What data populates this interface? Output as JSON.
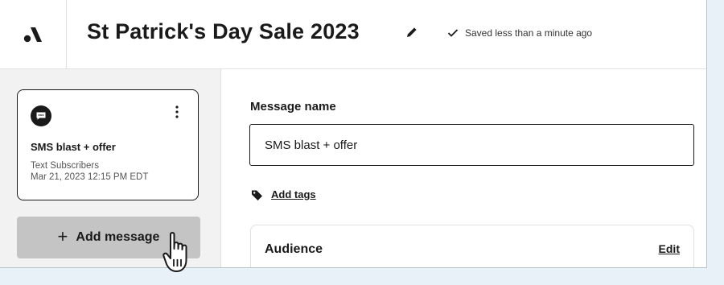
{
  "header": {
    "title": "St Patrick's Day Sale 2023",
    "saved_status": "Saved less than a minute ago",
    "logo_icon": "attentive-logo-icon",
    "edit_icon": "pencil-icon",
    "check_icon": "checkmark-icon"
  },
  "sidebar": {
    "message_card": {
      "icon": "sms-chat-icon",
      "menu_icon": "kebab-menu-icon",
      "title": "SMS blast + offer",
      "audience": "Text Subscribers",
      "scheduled": "Mar 21, 2023 12:15 PM EDT"
    },
    "add_message": {
      "plus": "+",
      "label": "Add message"
    }
  },
  "main": {
    "message_name_label": "Message name",
    "message_name_value": "SMS blast + offer",
    "add_tags_label": "Add tags",
    "tag_icon": "tag-icon",
    "audience": {
      "title": "Audience",
      "edit_label": "Edit"
    }
  },
  "colors": {
    "accent_dark": "#1a1a1a",
    "sidebar_bg": "#f2f2f2",
    "outer_bg": "#e8f1f7",
    "button_gray": "#c4c4c4"
  }
}
